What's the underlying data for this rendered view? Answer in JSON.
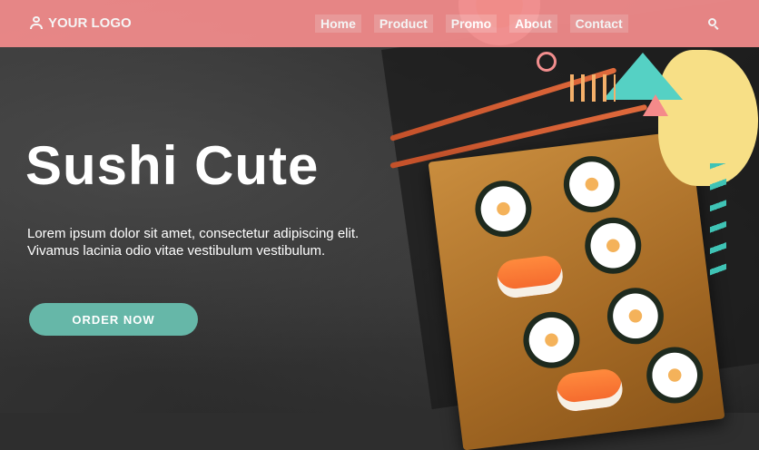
{
  "header": {
    "logo_text": "YOUR LOGO",
    "nav": [
      {
        "label": "Home"
      },
      {
        "label": "Product"
      },
      {
        "label": "Promo"
      },
      {
        "label": "About"
      },
      {
        "label": "Contact"
      }
    ],
    "search_icon": "search-icon",
    "accent_color": "#f08a8a"
  },
  "hero": {
    "title": "Sushi Cute",
    "description": "Lorem ipsum dolor sit amet, consectetur adipiscing elit. Vivamus lacinia odio vitae vestibulum vestibulum.",
    "cta_label": "ORDER NOW",
    "cta_color": "#66b7a8"
  }
}
